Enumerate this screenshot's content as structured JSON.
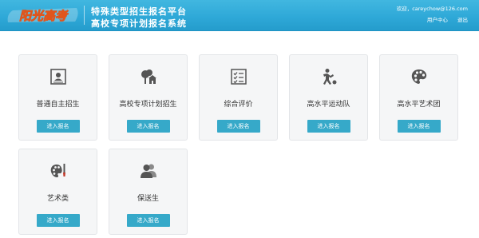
{
  "header": {
    "logo_text": "阳光高考",
    "title_line1": "特殊类型招生报名平台",
    "title_line2": "高校专项计划报名系统",
    "welcome": "欢迎，careychow@126.com",
    "user_center": "用户中心",
    "logout": "退出"
  },
  "cards": [
    {
      "label": "普通自主招生",
      "button": "进入报名",
      "icon": "id-card-icon"
    },
    {
      "label": "高校专项计划招生",
      "button": "进入报名",
      "icon": "school-tree-icon"
    },
    {
      "label": "综合评价",
      "button": "进入报名",
      "icon": "checklist-icon"
    },
    {
      "label": "高水平运动队",
      "button": "进入报名",
      "icon": "athlete-icon"
    },
    {
      "label": "高水平艺术团",
      "button": "进入报名",
      "icon": "palette-icon"
    },
    {
      "label": "艺术类",
      "button": "进入报名",
      "icon": "palette-brush-icon"
    },
    {
      "label": "保送生",
      "button": "进入报名",
      "icon": "users-icon"
    }
  ],
  "colors": {
    "header": "#2fa9d8",
    "button": "#36a9c9",
    "card_bg": "#f5f6f7",
    "icon": "#555555"
  }
}
